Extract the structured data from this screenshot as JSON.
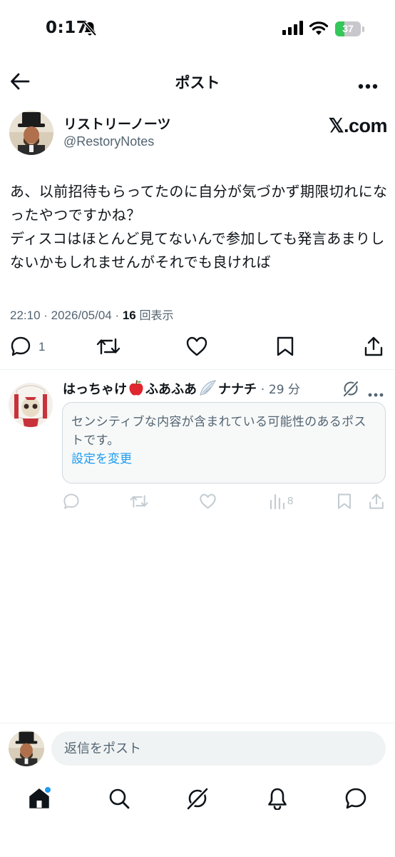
{
  "status_bar": {
    "time": "0:17",
    "battery": "37",
    "battery_level": 0.37
  },
  "header": {
    "title": "ポスト"
  },
  "post": {
    "author_name": "リストリーノーツ",
    "author_handle": "@RestoryNotes",
    "source_badge": "𝕏.com",
    "text": "あ、以前招待もらってたのに自分が気づかず期限切れになったやつですかね？\nディスコはほとんど見てないんで参加しても発言あまりしないかもしれませんがそれでも良ければ",
    "timestamp": "22:10 · 2026/05/04 · ",
    "views_count": "16",
    "views_label": "回表示",
    "reply_count": "1"
  },
  "reply": {
    "name_part1": "はっちゃけ",
    "name_part2": "ふあふあ",
    "name_part3": "ナナチ",
    "separator": "·",
    "time": "29 分",
    "sensitive_notice": "センシティブな内容が含まれている可能性のあるポストです。",
    "settings_link": "設定を変更",
    "views_count": "8"
  },
  "composer": {
    "placeholder": "返信をポスト"
  },
  "colors": {
    "text": "#0f1419",
    "secondary": "#536471",
    "link": "#1d9bf0",
    "divider": "#eff3f4",
    "battery": "#34c759"
  }
}
